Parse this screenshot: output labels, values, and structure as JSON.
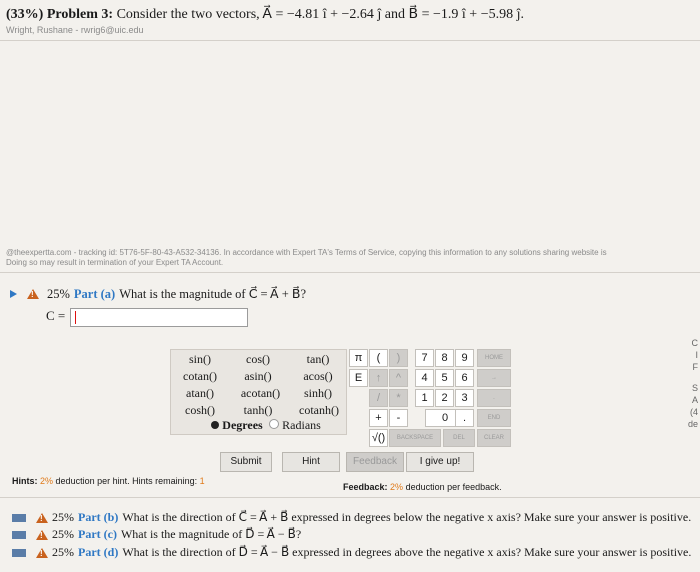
{
  "problem": {
    "weight": "(33%)",
    "label": "Problem 3:",
    "text": "Consider the two vectors, A⃗ = −4.81 î + −2.64 ĵ and B⃗ = −1.9 î + −5.98 ĵ."
  },
  "student": "Wright, Rushane - rwrig6@uic.edu",
  "tracking": {
    "line1": "@theexpertta.com - tracking id: 5T76-5F-80-43-A532-34136. In accordance with Expert TA's Terms of Service, copying this information to any solutions sharing website is",
    "line2": "Doing so may result in termination of your Expert TA Account."
  },
  "part_a": {
    "weight": "25%",
    "label": "Part (a)",
    "question": "What is the magnitude of C⃗ = A⃗ + B⃗?",
    "answer_label": "C =",
    "answer_value": ""
  },
  "functions": {
    "row1": [
      "sin()",
      "cos()",
      "tan()"
    ],
    "row2": [
      "cotan()",
      "asin()",
      "acos()"
    ],
    "row3": [
      "atan()",
      "acotan()",
      "sinh()"
    ],
    "row4": [
      "cosh()",
      "tanh()",
      "cotanh()"
    ],
    "degrees": "Degrees",
    "radians": "Radians"
  },
  "keypad": {
    "pi": "π",
    "lparen": "(",
    "rparen": ")",
    "e": "E",
    "up": "↑",
    "caret": "^",
    "slash": "/",
    "star": "*",
    "plus": "+",
    "minus": "-",
    "dot": ".",
    "sqrt": "√()",
    "digits": [
      "7",
      "8",
      "9",
      "4",
      "5",
      "6",
      "1",
      "2",
      "3",
      "0"
    ],
    "home": "HOME",
    "end": "END",
    "backspace": "BACKSPACE",
    "del": "DEL",
    "clear": "CLEAR",
    "arrow_right": "→"
  },
  "buttons": {
    "submit": "Submit",
    "hint": "Hint",
    "feedback": "Feedback",
    "give_up": "I give up!"
  },
  "hints": {
    "label": "Hints:",
    "percent": "2%",
    "text": "deduction per hint. Hints remaining:",
    "remaining": "1"
  },
  "feedback": {
    "label": "Feedback:",
    "percent": "2%",
    "text": "deduction per feedback."
  },
  "other_parts": [
    {
      "weight": "25%",
      "label": "Part (b)",
      "question": "What is the direction of C⃗ = A⃗ + B⃗ expressed in degrees below the negative x axis? Make sure your answer is positive."
    },
    {
      "weight": "25%",
      "label": "Part (c)",
      "question": "What is the magnitude of D⃗ = A⃗ − B⃗?"
    },
    {
      "weight": "25%",
      "label": "Part (d)",
      "question": "What is the direction of D⃗ = A⃗ − B⃗ expressed in degrees above the negative x axis? Make sure your answer is positive."
    }
  ],
  "side_fragments": [
    "C",
    "I",
    "F",
    "S",
    "A",
    "(4",
    "de"
  ]
}
